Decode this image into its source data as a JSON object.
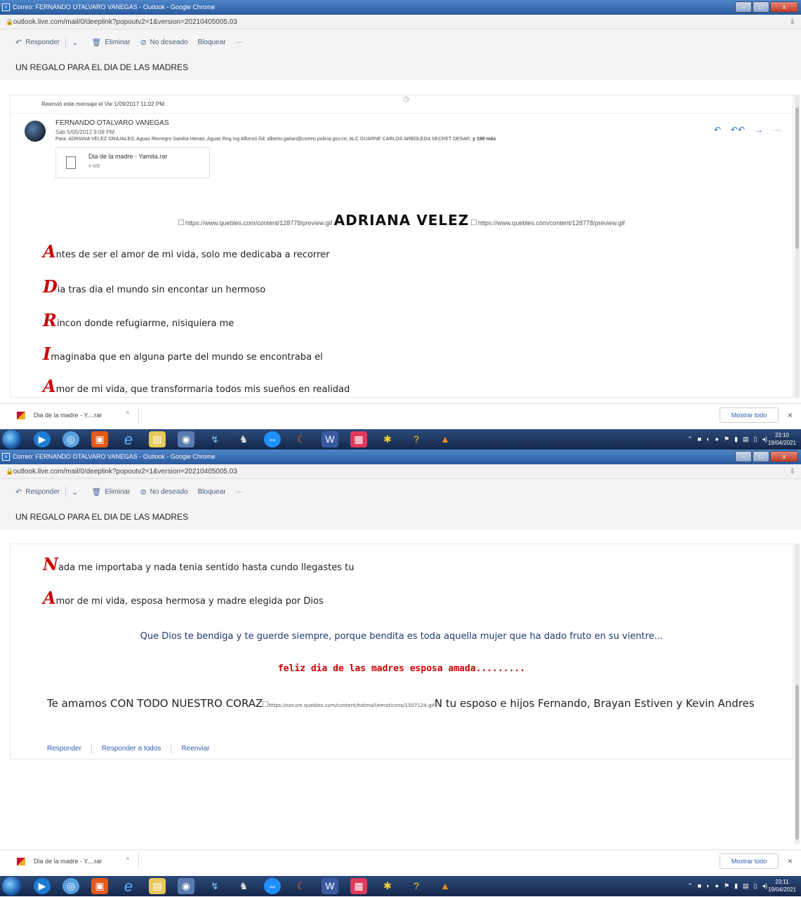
{
  "window": {
    "title": "Correo: FERNANDO OTALVARO VANEGAS - Outlook - Google Chrome",
    "url": "outlook.live.com/mail/0/deeplink?popoutv2=1&version=20210405005.03"
  },
  "toolbar": {
    "reply": "Responder",
    "delete": "Eliminar",
    "junk": "No deseado",
    "block": "Bloquear",
    "more": "···"
  },
  "email": {
    "subject": "UN REGALO PARA EL DIA DE LAS MADRES",
    "forwarded_note": "Reenvió este mensaje el Vie 1/09/2017 11:02 PM.",
    "sender_name": "FERNANDO OTALVARO VANEGAS",
    "sent_date": "Sáb 5/05/2012 9:08 PM",
    "to_prefix": "Para: ADRIANA VELEZ GRAJALES; Aguas Rionegro Sandra Henao; Aguas Rng Ing Alfonso Gil; alberto.gaitan@correo.policia.gov.co; ALC GUARNE CARLOS ARBOLEDA SECRET DESAR;",
    "to_more": "y 199 más",
    "attachment": {
      "name": "Dia de la madre - Yamita.rar",
      "size": "4 MB"
    },
    "header_img_alt": "https://www.quebles.com/content/128778/preview.gif",
    "header_name": "ADRIANA VELEZ",
    "poem": [
      {
        "cap": "A",
        "text": "ntes de ser el amor de mi vida, solo me dedicaba a recorrer"
      },
      {
        "cap": "D",
        "text": "ia tras dia el mundo sin encontar un hermoso"
      },
      {
        "cap": "R",
        "text": "incon donde refugiarme, nisiquiera me"
      },
      {
        "cap": "I",
        "text": "maginaba que en alguna parte del mundo se encontraba el"
      },
      {
        "cap": "A",
        "text": "mor de mi vida, que transformaria todos mis sueños en realidad"
      },
      {
        "cap": "N",
        "text": "ada me importaba y nada tenia sentido hasta cundo llegastes tu"
      },
      {
        "cap": "A",
        "text": "mor de mi vida, esposa hermosa y madre elegida por Dios"
      }
    ],
    "blessing": "Que Dios te bendiga y te guerde siempre, porque bendita es toda aquella mujer que ha dado fruto en su vientre...",
    "feliz": "feliz dia de las madres esposa amada.........",
    "love_start": "Te amamos CON TODO NUESTRO CORAZ",
    "love_img_alt": "https://secure.quebles.com/content/hotmail/emoticons/1507124.gif",
    "love_end": "N tu esposo e hijos    Fernando, Brayan Estiven y Kevin Andres",
    "footer": {
      "reply": "Responder",
      "reply_all": "Responder a todos",
      "forward": "Reenviar"
    }
  },
  "download": {
    "name": "Dia de la madre - Y....rar",
    "show_all": "Mostrar todo",
    "close": "×"
  },
  "taskbar": {
    "clock1_time": "23:10",
    "clock1_date": "19/04/2021",
    "clock2_time": "23:11",
    "clock2_date": "19/04/2021"
  },
  "colors": {
    "titlebar": "#2a5a9e",
    "cap_red": "#cc0000",
    "blessing_blue": "#1f3a70",
    "link_blue": "#2e5fb0"
  }
}
